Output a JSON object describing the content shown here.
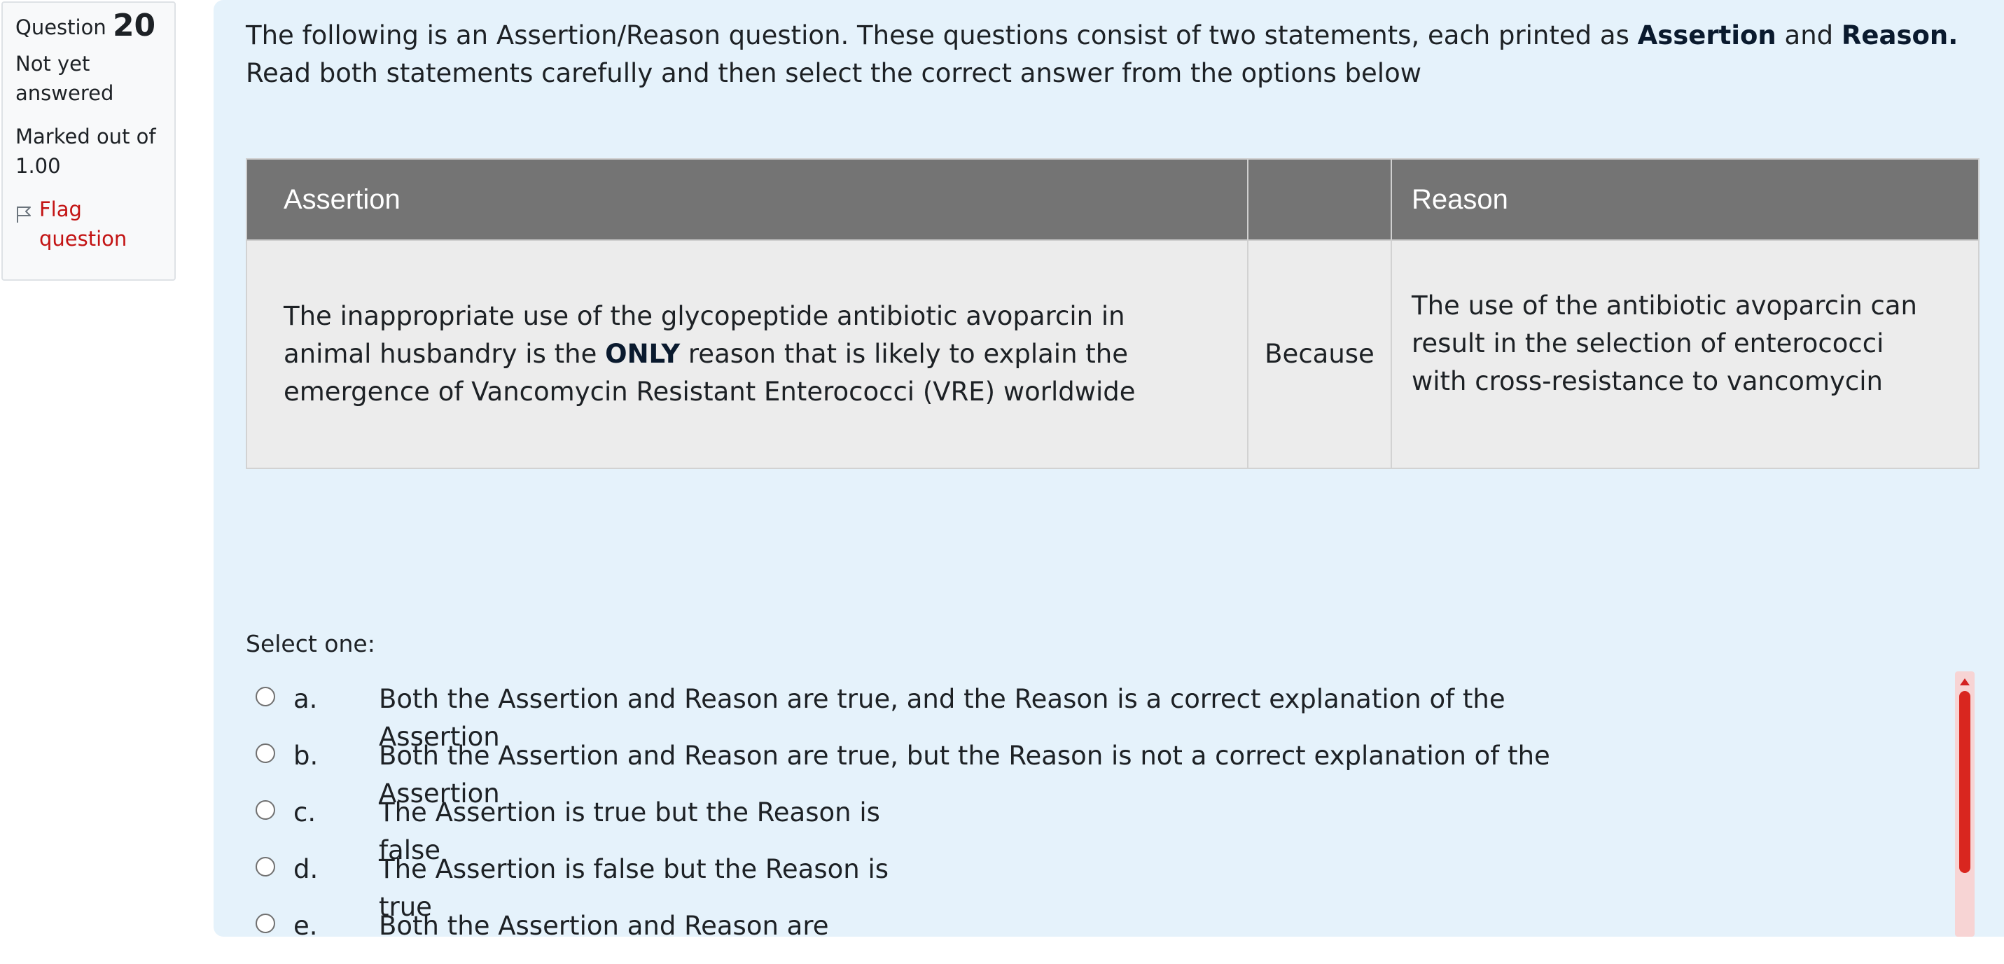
{
  "info": {
    "question_label": "Question",
    "question_number": "20",
    "state": "Not yet answered",
    "grade": "Marked out of 1.00",
    "flag_label": "Flag question"
  },
  "question": {
    "intro_part1": "The following is an Assertion/Reason question.  These questions consist of two statements, each printed as ",
    "intro_bold1": "Assertion",
    "intro_part2": " and ",
    "intro_bold2": "Reason.",
    "intro_line2": "Read both statements carefully and then select the correct answer from the options below"
  },
  "table": {
    "header_assertion": "Assertion",
    "header_middle": "",
    "header_reason": "Reason",
    "assertion_part1": "The inappropriate use of the glycopeptide antibiotic avoparcin in animal husbandry is the ",
    "assertion_bold": "ONLY",
    "assertion_part2": " reason that is likely to explain the emergence of Vancomycin Resistant Enterococci (VRE) worldwide",
    "connector": "Because",
    "reason": "The use of the antibiotic avoparcin can result in the selection of enterococci with cross-resistance to vancomycin"
  },
  "answers": {
    "prompt": "Select one:",
    "options": [
      {
        "letter": "a.",
        "text": "Both the Assertion and Reason are true, and the Reason is a correct explanation of the",
        "wrap": "Assertion"
      },
      {
        "letter": "b.",
        "text": "Both the Assertion and Reason are true, but the Reason is not a correct explanation of the",
        "wrap": "Assertion"
      },
      {
        "letter": "c.",
        "text": "The Assertion is true but the Reason is",
        "wrap": "false"
      },
      {
        "letter": "d.",
        "text": "The Assertion is false but the Reason is",
        "wrap": "true"
      },
      {
        "letter": "e.",
        "text": "Both the Assertion and Reason are",
        "wrap": ""
      }
    ]
  },
  "colors": {
    "panel_bg": "#e5f2fb",
    "table_header_bg": "#747474",
    "table_body_bg": "#ececec",
    "flag_red": "#c31313",
    "scrollbar_thumb": "#d9261f"
  }
}
